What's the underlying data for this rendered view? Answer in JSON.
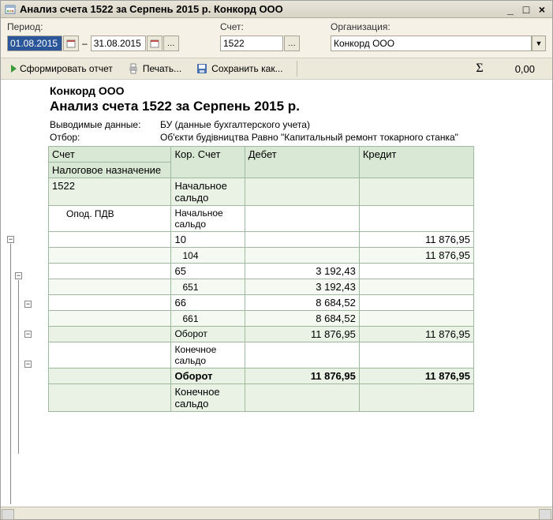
{
  "title": "Анализ счета 1522 за Серпень 2015 р. Конкорд ООО",
  "params": {
    "period_label": "Период:",
    "date_from": "01.08.2015",
    "date_to": "31.08.2015",
    "account_label": "Счет:",
    "account": "1522",
    "org_label": "Организация:",
    "org": "Конкорд ООО"
  },
  "toolbar": {
    "form": "Сформировать отчет",
    "print": "Печать...",
    "save": "Сохранить как...",
    "sum_value": "0,00"
  },
  "report": {
    "org": "Конкорд ООО",
    "title": "Анализ счета 1522 за Серпень 2015 р.",
    "meta1_label": "Выводимые данные:",
    "meta1_value": "БУ (данные бухгалтерского учета)",
    "meta2_label": "Отбор:",
    "meta2_value": "Об'єкти будівництва Равно \"Капитальный ремонт токарного станка\"",
    "cols": {
      "c1a": "Счет",
      "c1b": "Налоговое назначение",
      "c2": "Кор. Счет",
      "c3": "Дебет",
      "c4": "Кредит"
    },
    "rows": [
      {
        "acct": "1522",
        "kor": "Начальное сальдо",
        "d": "",
        "c": "",
        "cls": "h2"
      },
      {
        "acct": "Опод. ПДВ",
        "kor": "Начальное сальдо",
        "d": "",
        "c": "",
        "cls": "sub",
        "indent": true,
        "small": true
      },
      {
        "acct": "",
        "kor": "10",
        "d": "",
        "c": "11 876,95",
        "cls": "sub",
        "kind": true
      },
      {
        "acct": "",
        "kor": "104",
        "d": "",
        "c": "11 876,95",
        "cls": "alt",
        "kind2": true
      },
      {
        "acct": "",
        "kor": "65",
        "d": "3 192,43",
        "c": "",
        "cls": "sub",
        "kind": true
      },
      {
        "acct": "",
        "kor": "651",
        "d": "3 192,43",
        "c": "",
        "cls": "alt",
        "kind2": true
      },
      {
        "acct": "",
        "kor": "66",
        "d": "8 684,52",
        "c": "",
        "cls": "sub",
        "kind": true
      },
      {
        "acct": "",
        "kor": "661",
        "d": "8 684,52",
        "c": "",
        "cls": "alt",
        "kind2": true
      },
      {
        "acct": "",
        "kor": "Оборот",
        "d": "11 876,95",
        "c": "11 876,95",
        "cls": "h2",
        "small": true
      },
      {
        "acct": "",
        "kor": "Конечное сальдо",
        "d": "",
        "c": "",
        "cls": "sub",
        "small": true
      },
      {
        "acct": "",
        "kor": "Оборот",
        "d": "11 876,95",
        "c": "11 876,95",
        "cls": "tot"
      },
      {
        "acct": "",
        "kor": "Конечное сальдо",
        "d": "",
        "c": "",
        "cls": "h2"
      }
    ]
  }
}
